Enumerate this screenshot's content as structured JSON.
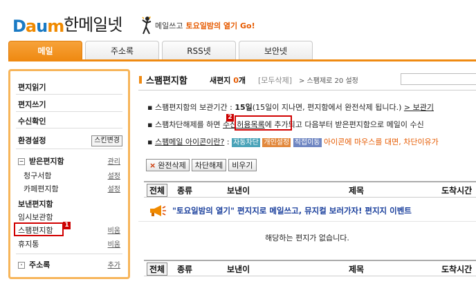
{
  "brand": {
    "logo": "Daum",
    "service": "한메일넷"
  },
  "promo": {
    "text": "메일쓰고",
    "highlight": "토요일밤의 열기 Go!"
  },
  "tabs": [
    {
      "label": "메일",
      "active": true
    },
    {
      "label": "주소록",
      "active": false
    },
    {
      "label": "RSS넷",
      "active": false
    },
    {
      "label": "보안넷",
      "active": false
    }
  ],
  "sidebar": {
    "read": "편지읽기",
    "write": "편지쓰기",
    "receipt": "수신확인",
    "settings": "환경설정",
    "skin_button": "스킨변경",
    "inbox": "받은편지함",
    "manage": "관리",
    "bill": "청구서함",
    "bill_setting": "설정",
    "cafe": "카페편지함",
    "cafe_setting": "설정",
    "sent": "보낸편지함",
    "draft": "임시보관함",
    "spam": "스팸편지함",
    "spam_action": "비움",
    "trash": "휴지통",
    "trash_action": "비움",
    "contacts": "주소록",
    "contacts_action": "추가"
  },
  "annotations": {
    "one": "1",
    "two": "2"
  },
  "main": {
    "title": "스팸편지함",
    "new_label": "새편지",
    "new_count": "0",
    "new_unit": "개",
    "delete_all": "[모두삭제]",
    "settings": "> 스팸제로 20 설정",
    "info1_pre": "▪ 스팸편지함의 보관기간 : ",
    "info1_days": "15일",
    "info1_post": "(15일이 지나면, 편지함에서 완전삭제 됩니다.)",
    "info1_link": "> 보관기",
    "info2_pre": "▪ 스팸차단해제를 하면 ",
    "info2_link": "수신허용목록",
    "info2_post": "에 추가되고 다음부터 받은편지함으로 메일이 수신",
    "info3_link": "스팸메일 아이콘이란?",
    "info3_pre": "▪ ",
    "info3_colon": " : ",
    "chip1": "자동차단",
    "chip2": "개인설정",
    "chip3": "직접이동",
    "info3_post": "아이콘에 마우스를 대면, 차단이유가",
    "btn_delete": "완전삭제",
    "btn_unblock": "차단해제",
    "btn_empty": "비우기",
    "btn_x": "×",
    "header": {
      "all": "전체",
      "type": "종류",
      "sender": "보낸이",
      "subject": "제목",
      "date": "도착시간"
    },
    "notice": "\"토요일밤의 열기\" 편지지로 메일쓰고, 뮤지컬 보러가자!  편지지 이벤트",
    "empty": "해당하는 편지가 없습니다."
  },
  "colors": {
    "accent": "#ef8a12",
    "annotation": "#d10000"
  }
}
